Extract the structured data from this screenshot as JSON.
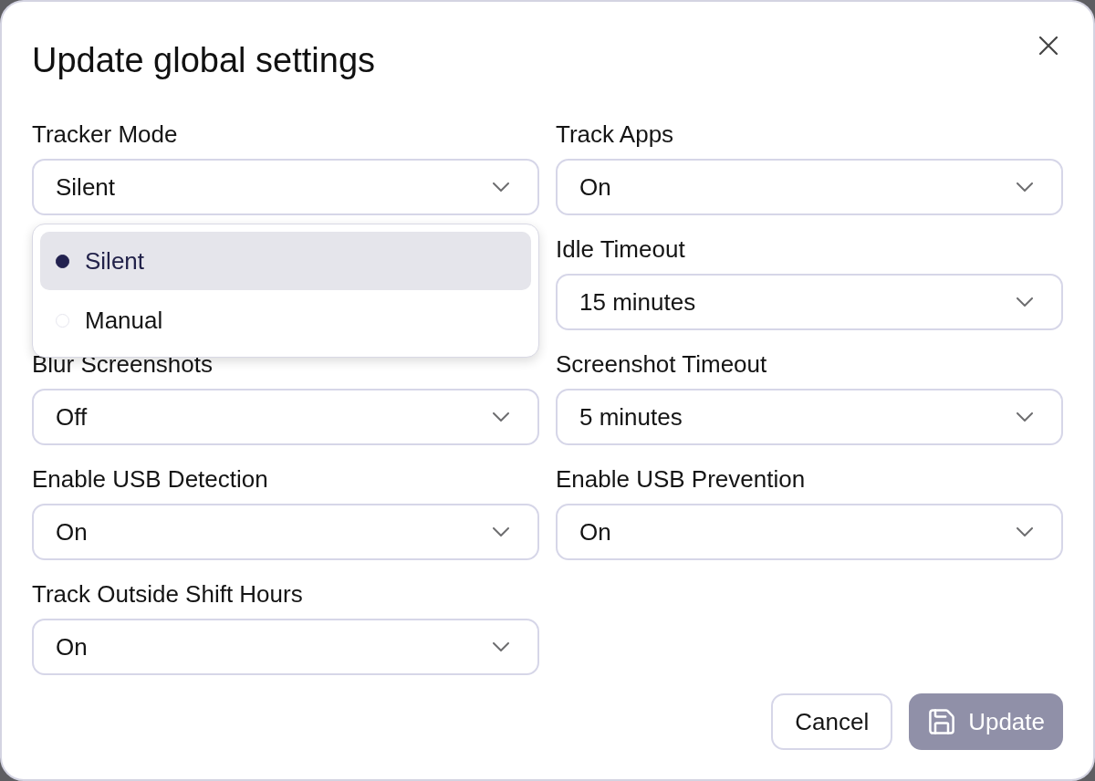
{
  "dialog": {
    "title": "Update global settings"
  },
  "rows": [
    {
      "left": {
        "label": "Tracker Mode",
        "value": "Silent",
        "menu": {
          "options": [
            {
              "label": "Silent",
              "selected": true
            },
            {
              "label": "Manual",
              "selected": false
            }
          ]
        }
      },
      "right": {
        "label": "Track Apps",
        "value": "On"
      }
    },
    {
      "right": {
        "label": "Idle Timeout",
        "value": "15 minutes"
      }
    },
    {
      "left": {
        "label": "Blur Screenshots",
        "value": "Off"
      },
      "right": {
        "label": "Screenshot Timeout",
        "value": "5 minutes"
      }
    },
    {
      "left": {
        "label": "Enable USB Detection",
        "value": "On"
      },
      "right": {
        "label": "Enable USB Prevention",
        "value": "On"
      }
    },
    {
      "left": {
        "label": "Track Outside Shift Hours",
        "value": "On"
      }
    }
  ],
  "buttons": [
    {
      "label": "Cancel",
      "kind": "cancel",
      "disabled": false
    },
    {
      "label": "Update",
      "kind": "save",
      "disabled": true
    }
  ]
}
